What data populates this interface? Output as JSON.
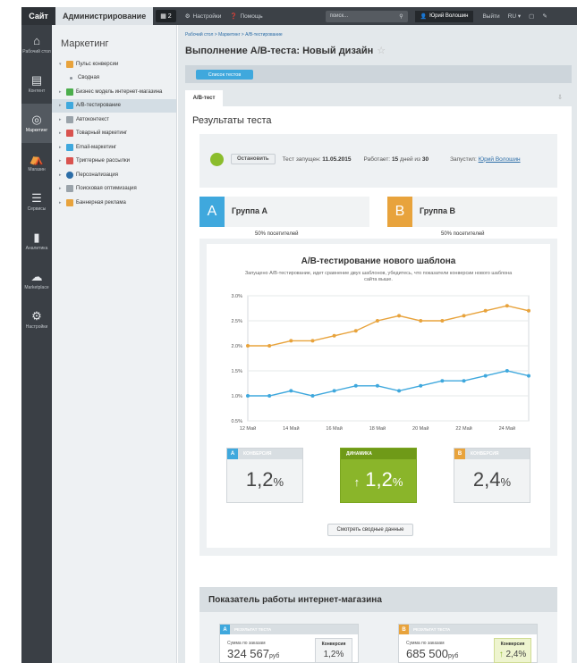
{
  "topbar": {
    "site": "Сайт",
    "admin": "Администрирование",
    "badge": "2",
    "settings": "Настройки",
    "help": "Помощь",
    "search_placeholder": "поиск...",
    "user": "Юрий Волошин",
    "logout": "Выйти",
    "lang": "RU"
  },
  "rail": [
    {
      "label": "Рабочий стол",
      "icon": "home-icon"
    },
    {
      "label": "Контент",
      "icon": "document-icon"
    },
    {
      "label": "Маркетинг",
      "icon": "target-icon"
    },
    {
      "label": "Магазин",
      "icon": "shop-icon"
    },
    {
      "label": "Сервисы",
      "icon": "layers-icon"
    },
    {
      "label": "Аналитика",
      "icon": "analytics-icon"
    },
    {
      "label": "Marketplace",
      "icon": "cloud-icon"
    },
    {
      "label": "Настройки",
      "icon": "settings-icon"
    }
  ],
  "menu": {
    "title": "Маркетинг",
    "items": [
      {
        "label": "Пульс конверсии",
        "color": "#e8a33c"
      },
      {
        "label": "Сводная",
        "color": ""
      },
      {
        "label": "Бизнес модель интернет-магазина",
        "color": "#4cae4c"
      },
      {
        "label": "А/В-тестирование",
        "color": "#3fa8dd"
      },
      {
        "label": "Автоконтекст",
        "color": "#9aa3aa"
      },
      {
        "label": "Товарный маркетинг",
        "color": "#d9534f"
      },
      {
        "label": "Email-маркетинг",
        "color": "#3fa8dd"
      },
      {
        "label": "Триггерные рассылки",
        "color": "#d9534f"
      },
      {
        "label": "Персонализация",
        "color": "#2c6da7"
      },
      {
        "label": "Поисковая оптимизация",
        "color": "#9aa3aa"
      },
      {
        "label": "Баннерная реклама",
        "color": "#e8a33c"
      }
    ]
  },
  "main": {
    "breadcrumbs": "Рабочий стол  >  Маркетинг  >  А/В-тестирование",
    "title": "Выполнение А/В-теста: Новый дизайн",
    "list_button": "Список тестов",
    "tab": "А/В-тест",
    "results_title": "Результаты теста",
    "stop_button": "Остановить",
    "started_label": "Тест запущен:",
    "started_value": "11.05.2015",
    "works_label": "Работает:",
    "works_value": "15",
    "works_suffix": "дней из",
    "works_total": "30",
    "launched_label": "Запустил:",
    "launched_by": "Юрий Волошин",
    "group_a_letter": "A",
    "group_a": "Группа А",
    "group_a_pct": "50% посетителей",
    "group_b_letter": "B",
    "group_b": "Группа В",
    "group_b_pct": "50% посетителей",
    "color_a": "#3fa8dd",
    "color_b": "#e8a33c",
    "color_dynamic": "#8ab52a"
  },
  "chart_data": {
    "type": "line",
    "title": "А/В-тестирование нового шаблона",
    "subtitle": "Запущено А/В-тестирование, идет сравнение двух шаблонов, убедитесь, что показатели конверсии нового шаблона сайта выше.",
    "x": [
      "12 Май",
      "13 Май",
      "14 Май",
      "15 Май",
      "16 Май",
      "17 Май",
      "18 Май",
      "19 Май",
      "20 Май",
      "21 Май",
      "22 Май",
      "23 Май",
      "24 Май",
      "25 Май"
    ],
    "x_tick_labels": [
      "12 Май",
      "14 Май",
      "16 Май",
      "18 Май",
      "20 Май",
      "22 Май",
      "24 Май"
    ],
    "ylim": [
      0.5,
      3.0
    ],
    "y_ticks": [
      "0.5%",
      "1.0%",
      "1.5%",
      "2.0%",
      "2.5%",
      "3.0%"
    ],
    "grid": true,
    "series": [
      {
        "color": "#e8a33c",
        "values": [
          2.0,
          2.0,
          2.1,
          2.1,
          2.2,
          2.3,
          2.5,
          2.6,
          2.5,
          2.5,
          2.6,
          2.7,
          2.8,
          2.7
        ]
      },
      {
        "color": "#3fa8dd",
        "values": [
          1.0,
          1.0,
          1.1,
          1.0,
          1.1,
          1.2,
          1.2,
          1.1,
          1.2,
          1.3,
          1.3,
          1.4,
          1.5,
          1.4
        ]
      }
    ]
  },
  "metrics": {
    "conv_a_label": "КОНВЕРСИЯ",
    "conv_a_letter": "A",
    "conv_a_value": "1,2",
    "dynamic_label": "ДИНАМИКА",
    "dynamic_arrow": "↑",
    "dynamic_value": "1,2",
    "conv_b_label": "КОНВЕРСИЯ",
    "conv_b_letter": "B",
    "conv_b_value": "2,4",
    "percent": "%",
    "summary_button": "Смотреть сводные данные"
  },
  "shop": {
    "title": "Показатель работы интернет-магазина",
    "card_label": "РЕЗУЛЬТАТ ТЕСТА",
    "sum_label": "Сумма по заказам",
    "a_letter": "A",
    "a_sum": "324 567",
    "b_letter": "B",
    "b_sum": "685 500",
    "currency": "руб",
    "conv_label": "Конверсия",
    "a_conv": "1,2%",
    "b_conv_arrow": "↑",
    "b_conv": "2,4%"
  }
}
